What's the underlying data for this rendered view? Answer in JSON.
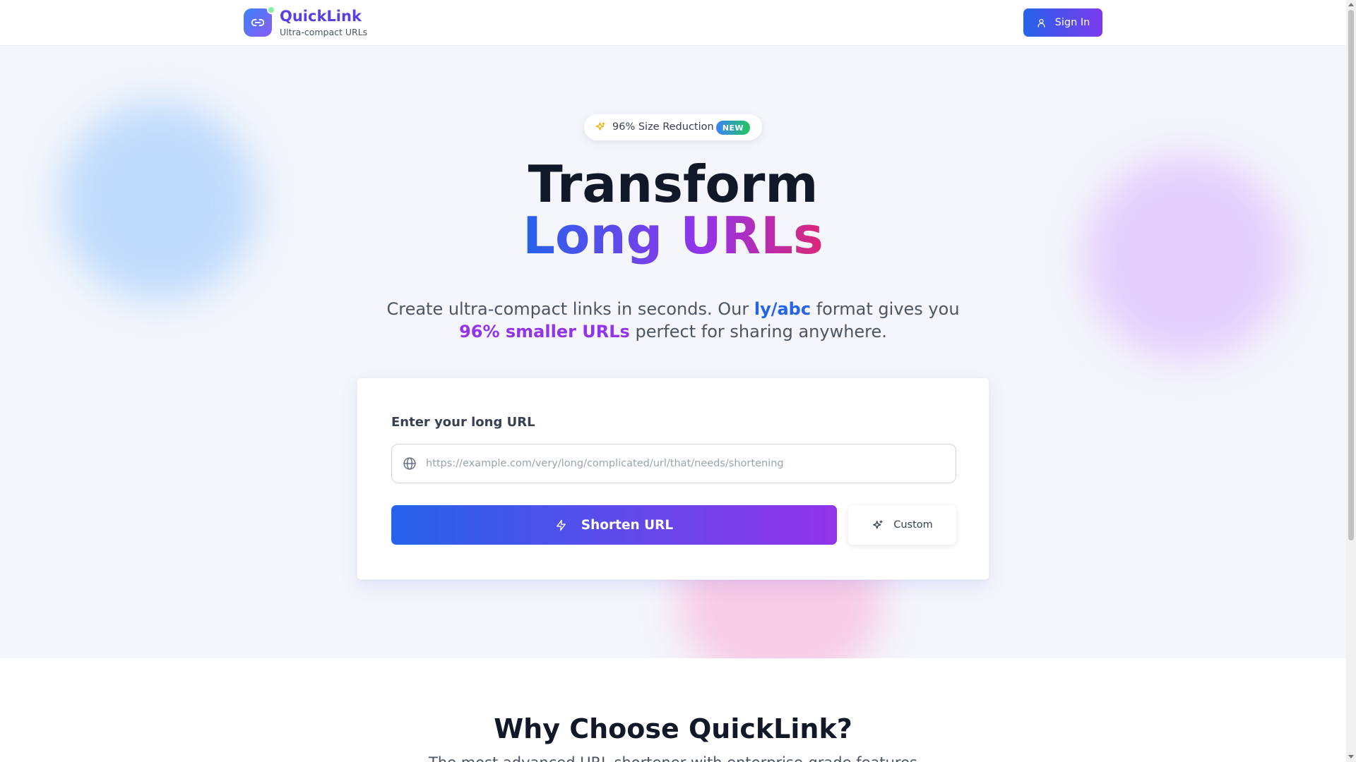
{
  "header": {
    "brand_name": "QuickLink",
    "brand_tagline": "Ultra-compact URLs",
    "logo_icon": "link-icon",
    "signin_label": "Sign In",
    "signin_icon": "user-icon"
  },
  "hero": {
    "badge_text": "96% Size Reduction",
    "badge_tag": "NEW",
    "badge_icon": "sparkles-icon",
    "title_line1": "Transform",
    "title_line2": "Long URLs",
    "subtitle": {
      "part1": "Create ultra-compact links in seconds. Our ",
      "highlight1": "ly/abc",
      "part2": " format gives you ",
      "highlight2": "96% smaller URLs",
      "part3": " perfect for sharing anywhere."
    }
  },
  "shortener": {
    "label": "Enter your long URL",
    "input_value": "",
    "input_placeholder": "https://example.com/very/long/complicated/url/that/needs/shortening",
    "input_icon": "globe-icon",
    "shorten_label": "Shorten URL",
    "shorten_icon": "zap-icon",
    "custom_label": "Custom",
    "custom_icon": "sparkles-icon"
  },
  "features": {
    "title": "Why Choose QuickLink?",
    "subtitle": "The most advanced URL shortener with enterprise-grade features"
  },
  "colors": {
    "brand_gradient_start": "#2563eb",
    "brand_gradient_end": "#9333ea",
    "title_color": "#111827",
    "accent_blue": "#2563eb",
    "accent_purple": "#9333ea"
  }
}
